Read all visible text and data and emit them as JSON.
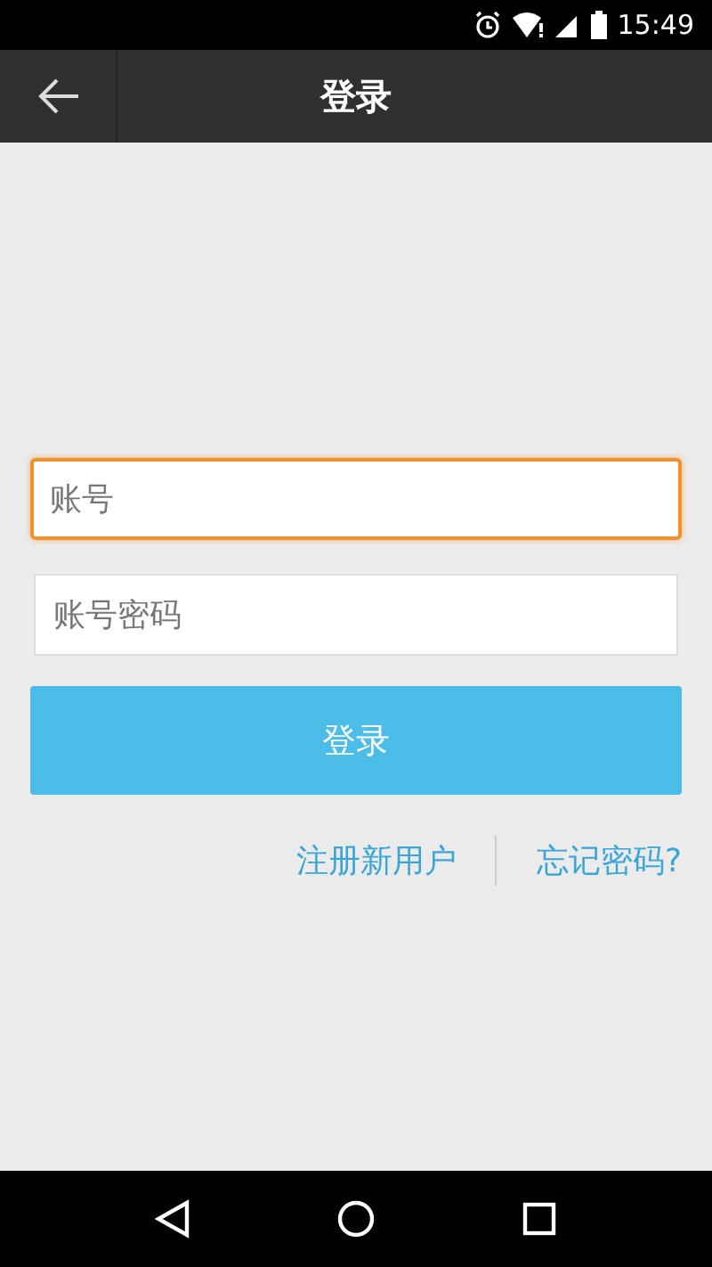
{
  "status_bar": {
    "time": "15:49"
  },
  "app_bar": {
    "title": "登录"
  },
  "fields": [
    {
      "placeholder": "账号",
      "focused": true
    },
    {
      "placeholder": "账号密码",
      "focused": false
    }
  ],
  "login_button": {
    "label": "登录"
  },
  "links": [
    {
      "label": "注册新用户"
    },
    {
      "label": "忘记密码?"
    }
  ]
}
